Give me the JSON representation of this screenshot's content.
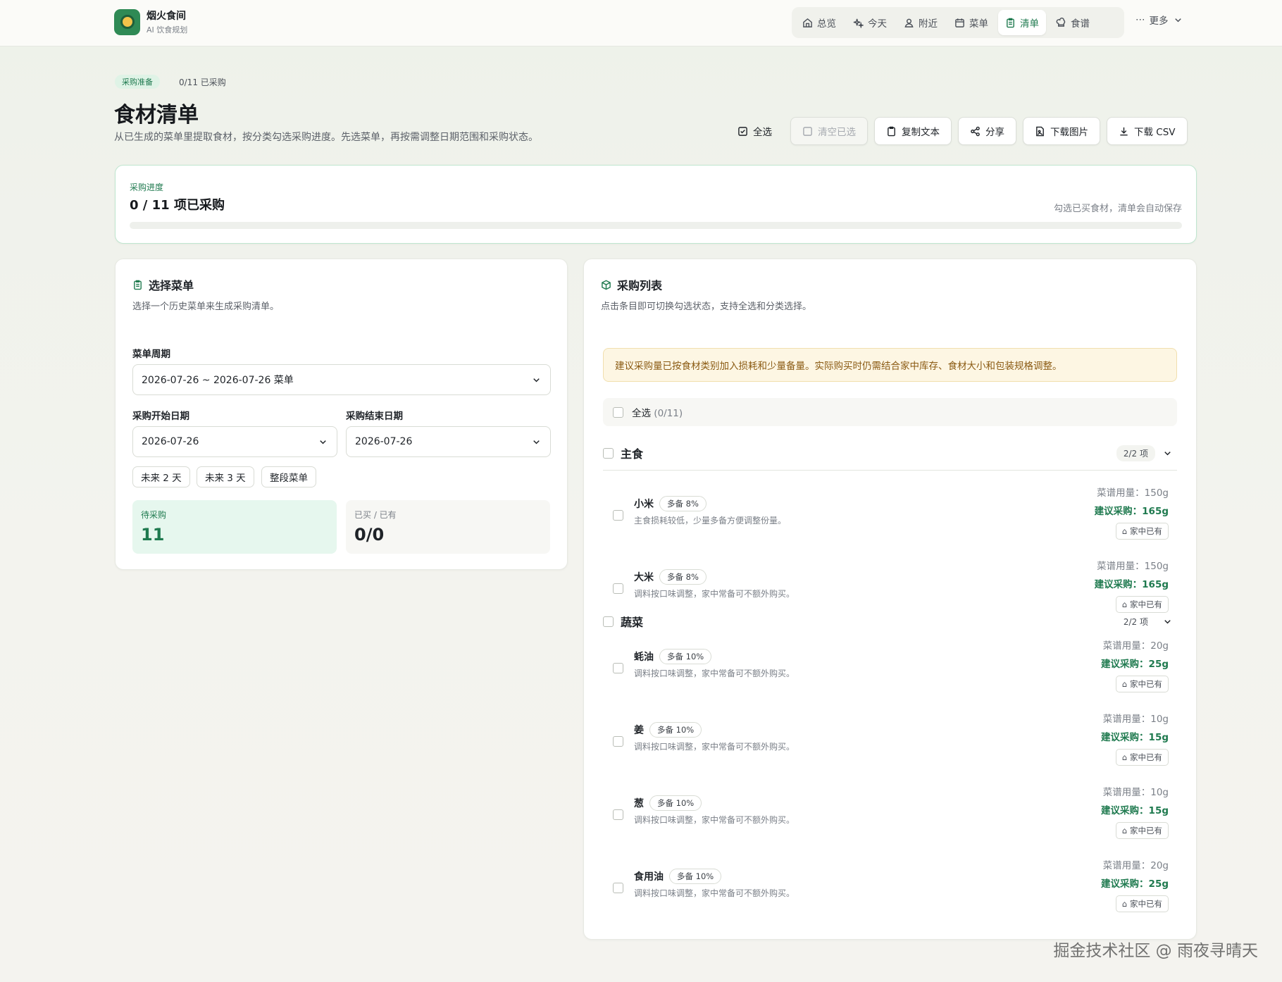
{
  "brand": {
    "name": "烟火食间",
    "subtitle": "AI 饮食规划"
  },
  "nav": [
    {
      "label": "总览",
      "icon": "home-icon"
    },
    {
      "label": "今天",
      "icon": "sparkles-icon"
    },
    {
      "label": "附近",
      "icon": "user-location-icon"
    },
    {
      "label": "菜单",
      "icon": "calendar-icon"
    },
    {
      "label": "清单",
      "icon": "clipboard-icon",
      "active": true
    },
    {
      "label": "食谱",
      "icon": "chef-hat-icon"
    }
  ],
  "nav_more": "更多",
  "header": {
    "tag": "采购准备",
    "count": "0/11 已采购",
    "title": "食材清单",
    "description": "从已生成的菜单里提取食材，按分类勾选采购进度。先选菜单，再按需调整日期范围和采购状态。"
  },
  "actions": {
    "select_all": "全选",
    "clear_selected": "清空已选",
    "copy_text": "复制文本",
    "share": "分享",
    "download_image": "下载图片",
    "download_csv": "下载 CSV"
  },
  "progress": {
    "label": "采购进度",
    "title": "0 / 11 项已采购",
    "hint": "勾选已买食材，清单会自动保存",
    "percent": 0
  },
  "menu_select": {
    "title": "选择菜单",
    "description": "选择一个历史菜单来生成采购清单。",
    "period_label": "菜单周期",
    "period_value": "2026-07-26 ~ 2026-07-26 菜单",
    "start_label": "采购开始日期",
    "start_value": "2026-07-26",
    "end_label": "采购结束日期",
    "end_value": "2026-07-26",
    "quick": [
      "未来 2 天",
      "未来 3 天",
      "整段菜单"
    ],
    "pending_label": "待采购",
    "pending_value": "11",
    "bought_label": "已买 / 已有",
    "bought_value": "0/0"
  },
  "shopping": {
    "title": "采购列表",
    "description": "点击条目即可切换勾选状态，支持全选和分类选择。",
    "notice": "建议采购量已按食材类别加入损耗和少量备量。实际购买时仍需结合家中库存、食材大小和包装规格调整。",
    "select_all": "全选",
    "select_all_count": "(0/11)",
    "home_label": "家中已有",
    "groups": [
      {
        "name": "主食",
        "count": "2/2 项"
      },
      {
        "name": "蔬菜",
        "count": "2/2 项"
      }
    ],
    "items": [
      {
        "name": "小米",
        "tag": "多备 8%",
        "note": "主食损耗较低，少量多备方便调整份量。",
        "usage": "菜谱用量：150g",
        "buy": "建议采购：165g"
      },
      {
        "name": "大米",
        "tag": "多备 8%",
        "note": "调料按口味调整，家中常备可不额外购买。",
        "usage": "菜谱用量：150g",
        "buy": "建议采购：165g"
      },
      {
        "name": "蚝油",
        "tag": "多备 10%",
        "note": "调料按口味调整，家中常备可不额外购买。",
        "usage": "菜谱用量：20g",
        "buy": "建议采购：25g"
      },
      {
        "name": "姜",
        "tag": "多备 10%",
        "note": "调料按口味调整，家中常备可不额外购买。",
        "usage": "菜谱用量：10g",
        "buy": "建议采购：15g"
      },
      {
        "name": "葱",
        "tag": "多备 10%",
        "note": "调料按口味调整，家中常备可不额外购买。",
        "usage": "菜谱用量：10g",
        "buy": "建议采购：15g"
      },
      {
        "name": "食用油",
        "tag": "多备 10%",
        "note": "调料按口味调整，家中常备可不额外购买。",
        "usage": "菜谱用量：20g",
        "buy": "建议采购：25g"
      }
    ]
  },
  "watermark": "掘金技术社区 @ 雨夜寻晴天",
  "colors": {
    "accent": "#1f7a4f",
    "notice_bg": "#fdf6e3",
    "notice_text": "#8a5a12"
  }
}
